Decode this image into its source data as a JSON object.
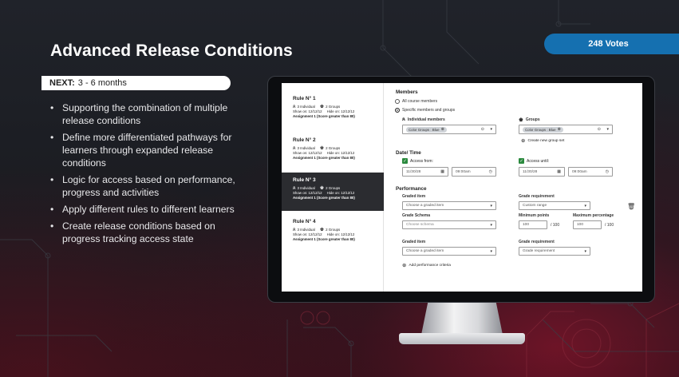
{
  "slide": {
    "title": "Advanced Release Conditions",
    "votes": "248 Votes",
    "next_label": "NEXT:",
    "next_range": "3 - 6 months",
    "bullets": [
      "Supporting the combination of multiple release conditions",
      "Define more differentiated pathways for learners through expanded release conditions",
      "Logic for access based on performance, progress and activities",
      "Apply different rules to different learners",
      "Create release conditions based on progress tracking access state"
    ]
  },
  "rules": [
    {
      "title": "Rule N° 1",
      "individual": "3 Individual",
      "groups": "2 Groups",
      "show": "Show on: 12/12/12",
      "hide": "Hide on: 12/12/12",
      "assignment": "Assignment 1 (Score greater than 80)"
    },
    {
      "title": "Rule N° 2",
      "individual": "3 Individual",
      "groups": "2 Groups",
      "show": "Show on: 12/12/12",
      "hide": "Hide on: 12/12/12",
      "assignment": "Assignment 1 (Score greater than 80)"
    },
    {
      "title": "Rule N° 3",
      "individual": "3 Individual",
      "groups": "2 Groups",
      "show": "Show on: 12/12/12",
      "hide": "Hide on: 12/12/12",
      "assignment": "Assignment 1 (Score greater than 80)"
    },
    {
      "title": "Rule N° 4",
      "individual": "3 Individual",
      "groups": "2 Groups",
      "show": "Show on: 12/12/12",
      "hide": "Hide on: 12/12/12",
      "assignment": "Assignment 1 (Score greater than 80)"
    }
  ],
  "form": {
    "members_heading": "Members",
    "all_members": "All course members",
    "specific_members": "Specific members and groups",
    "individual_label": "Individual members",
    "groups_label": "Groups",
    "individual_chip": "Color Groups : Blue",
    "groups_chip": "Color Groups : Blue",
    "create_group": "Create new group set",
    "datetime_heading": "Date/ Time",
    "access_from": "Access from:",
    "access_until": "Access until:",
    "date_from": "11/30/28",
    "time_from": "09:00am",
    "date_until": "11/30/28",
    "time_until": "09:00am",
    "performance_heading": "Performance",
    "graded_item_label": "Graded item",
    "graded_item_placeholder": "Choose a graded item",
    "grade_req_label": "Grade requirement",
    "grade_req_value": "Custom range",
    "grade_schema_label": "Grade Schema",
    "grade_schema_placeholder": "Choose schema",
    "min_points_label": "Minimum points",
    "max_pct_label": "Maximum percentage",
    "min_points_value": "100",
    "min_points_total": "/ 100",
    "max_pct_value": "100",
    "max_pct_total": "/ 100",
    "graded_item2_label": "Graded item",
    "graded_item2_placeholder": "Choose a graded item",
    "grade_req2_label": "Grade requirement",
    "grade_req2_placeholder": "Grade requirement",
    "add_criteria": "Add performance criteria"
  },
  "colors": {
    "accent_blue": "#1570b0",
    "active_rule": "#2b2c30",
    "check_green": "#2b8a3e"
  }
}
